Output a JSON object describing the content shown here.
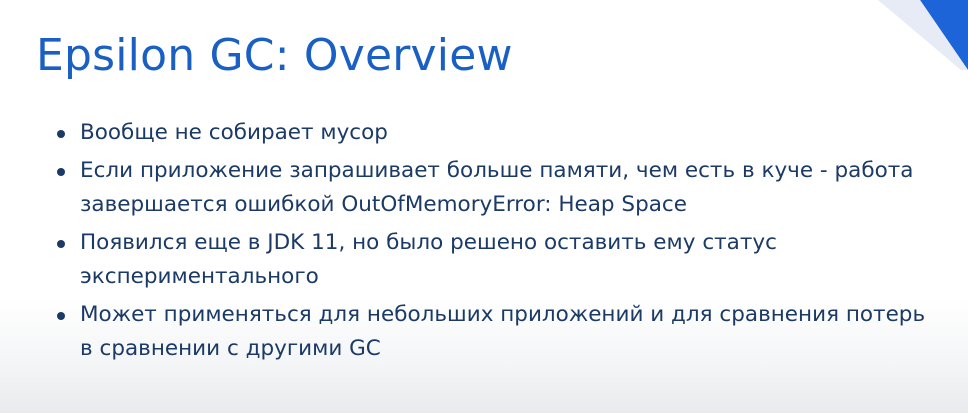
{
  "slide": {
    "title": "Epsilon GC: Overview",
    "accent_color": "#1a5fc4",
    "text_color": "#1b3a66",
    "bullets": [
      "Вообще не собирает мусор",
      "Если приложение запрашивает больше памяти, чем есть в куче - работа завершается ошибкой OutOfMemoryError: Heap Space",
      "Появился еще в JDK 11, но было решено оставить ему статус экспериментального",
      "Может применяться для небольших приложений и для сравнения потерь в сравнении с другими GC"
    ]
  }
}
